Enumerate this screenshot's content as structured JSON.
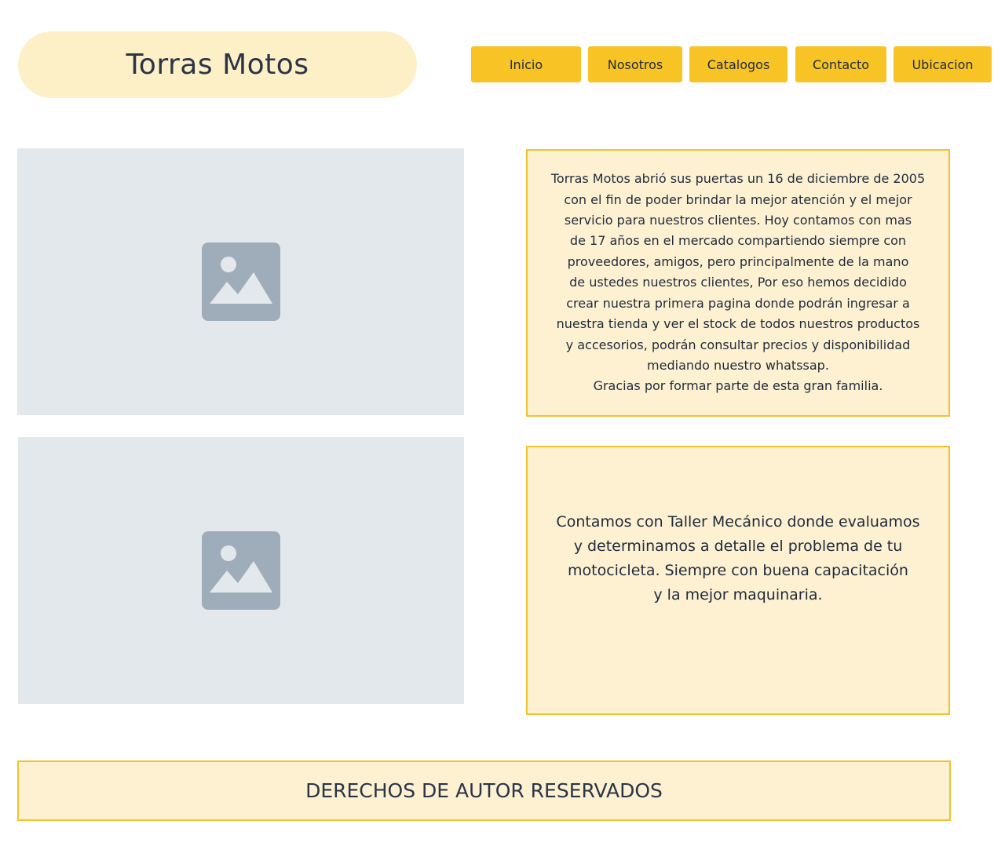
{
  "header": {
    "site_title": "Torras Motos"
  },
  "nav": {
    "items": [
      {
        "label": "Inicio"
      },
      {
        "label": "Nosotros"
      },
      {
        "label": "Catalogos"
      },
      {
        "label": "Contacto"
      },
      {
        "label": "Ubicacion"
      }
    ]
  },
  "content": {
    "about_text": "Torras Motos abrió sus puertas un 16 de diciembre de 2005\ncon el fin de poder brindar la mejor atención y el mejor\nservicio para nuestros clientes. Hoy contamos con mas\nde 17 años en el mercado compartiendo siempre con\nproveedores, amigos, pero principalmente de la mano\nde ustedes nuestros clientes, Por eso hemos decidido\ncrear nuestra primera pagina donde podrán ingresar a\nnuestra tienda y ver el stock de todos nuestros productos\ny accesorios, podrán consultar precios y disponibilidad\nmediando nuestro whatssap.\nGracias por formar parte de esta gran familia.",
    "workshop_text": "Contamos con Taller Mecánico donde evaluamos\ny determinamos a detalle el problema de tu\nmotocicleta. Siempre con buena capacitación\ny la mejor maquinaria."
  },
  "footer": {
    "text": "DERECHOS DE AUTOR RESERVADOS"
  },
  "colors": {
    "accent": "#f7c325",
    "panel_bg": "#fdf1d1",
    "panel_border": "#f5c22f",
    "placeholder_bg": "#e3e8ec",
    "placeholder_icon": "#9fadba"
  },
  "icons": {
    "image_placeholder": "image-icon"
  }
}
